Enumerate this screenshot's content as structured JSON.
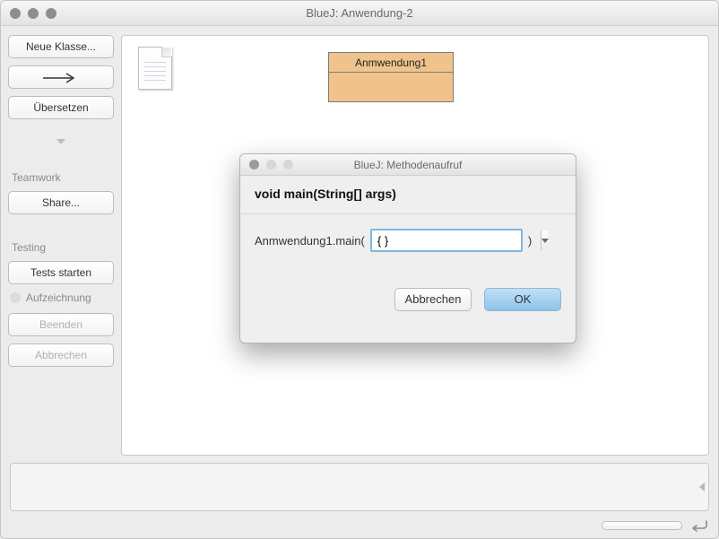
{
  "window": {
    "title": "BlueJ:  Anwendung-2"
  },
  "sidebar": {
    "new_class": "Neue Klasse...",
    "compile": "Übersetzen",
    "teamwork_label": "Teamwork",
    "share": "Share...",
    "testing_label": "Testing",
    "start_tests": "Tests starten",
    "record": "Aufzeichnung",
    "end": "Beenden",
    "cancel": "Abbrechen"
  },
  "canvas": {
    "classes": [
      {
        "name": "Anmwendung1"
      }
    ]
  },
  "dialog": {
    "title": "BlueJ:  Methodenaufruf",
    "signature": "void main(String[] args)",
    "call_prefix": "Anmwendung1.main(",
    "arg_value": "{ }",
    "call_suffix": ")",
    "buttons": {
      "cancel": "Abbrechen",
      "ok": "OK"
    }
  }
}
